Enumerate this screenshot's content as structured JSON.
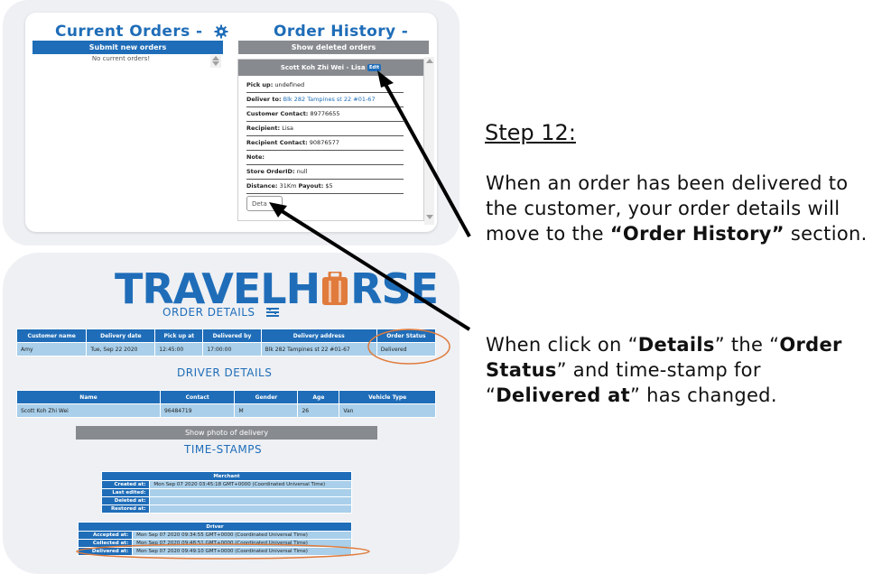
{
  "current_orders": {
    "title": "Current Orders -",
    "submit_label": "Submit new orders",
    "empty_text": "No current orders!"
  },
  "order_history": {
    "title": "Order History -",
    "show_deleted_label": "Show deleted orders",
    "card": {
      "header": "Scott Koh Zhi Wei - Lisa",
      "badge": "Edit",
      "pickup_label": "Pick up:",
      "pickup_value": "undefined",
      "deliver_label": "Deliver to:",
      "deliver_value": "Blk 282 Tampines st 22 #01-67",
      "customer_contact_label": "Customer Contact:",
      "customer_contact_value": "89776655",
      "recipient_label": "Recipient:",
      "recipient_value": "Lisa",
      "recipient_contact_label": "Recipient Contact:",
      "recipient_contact_value": "90876577",
      "note_label": "Note:",
      "store_orderid_label": "Store OrderID:",
      "store_orderid_value": "null",
      "distance_label": "Distance:",
      "distance_value": "31Km",
      "payout_label": "Payout:",
      "payout_value": "$5",
      "details_button": "Deta"
    }
  },
  "logo": {
    "left": "TRAVELH",
    "right": "RSE"
  },
  "order_details": {
    "title": "ORDER DETAILS",
    "headers": [
      "Customer name",
      "Delivery date",
      "Pick up at",
      "Delivered by",
      "Delivery address",
      "Order Status"
    ],
    "row": [
      "Amy",
      "Tue, Sep 22 2020",
      "12:45:00",
      "17:00:00",
      "Blk 282 Tampines st 22 #01-67",
      "Delivered"
    ]
  },
  "driver_details": {
    "title": "DRIVER DETAILS",
    "headers": [
      "Name",
      "Contact",
      "Gender",
      "Age",
      "Vehicle Type"
    ],
    "row": [
      "Scott Koh Zhi Wei",
      "96484719",
      "M",
      "26",
      "Van"
    ]
  },
  "show_photo_label": "Show photo of delivery",
  "timestamps": {
    "title": "TIME-STAMPS",
    "merchant_head": "Merchant",
    "merchant_rows": [
      {
        "label": "Created at:",
        "value": "Mon Sep 07 2020 03:45:18 GMT+0000 (Coordinated Universal Time)"
      },
      {
        "label": "Last edited:",
        "value": ""
      },
      {
        "label": "Deleted at:",
        "value": ""
      },
      {
        "label": "Restored at:",
        "value": ""
      }
    ],
    "driver_head": "Driver",
    "driver_rows": [
      {
        "label": "Accepted at:",
        "value": "Mon Sep 07 2020 09:34:55 GMT+0000 (Coordinated Universal Time)"
      },
      {
        "label": "Collected at:",
        "value": "Mon Sep 07 2020 09:48:51 GMT+0000 (Coordinated Universal Time)"
      },
      {
        "label": "Delivered at:",
        "value": "Mon Sep 07 2020 09:49:10 GMT+0000 (Coordinated Universal Time)"
      }
    ]
  },
  "instructions": {
    "step_title": "Step 12:",
    "p1_a": "When an order has been delivered to the customer, your order details will move to the ",
    "p1_b": "“Order History”",
    "p1_c": " section.",
    "p2_a": "When click on “",
    "p2_b": "Details",
    "p2_c": "” the “",
    "p2_d": "Order Status",
    "p2_e": "” and time-stamp for “",
    "p2_f": "Delivered at",
    "p2_g": "” has changed."
  },
  "colors": {
    "brand_blue": "#1f6db8",
    "bar_gray": "#878a8f",
    "cell_blue": "#a9cfea",
    "highlight_orange": "#e07b3c"
  }
}
